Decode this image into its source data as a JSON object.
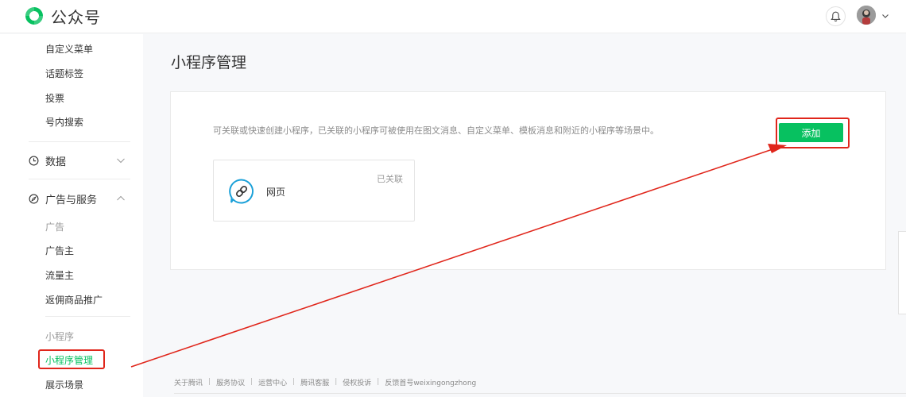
{
  "brand": {
    "name": "公众号",
    "logo_icon": "wechat-official-account-logo",
    "accent": "#07c160"
  },
  "header": {
    "notification_icon": "bell-icon",
    "avatar_icon": "avatar",
    "dropdown_icon": "chevron-down-icon"
  },
  "sidebar": {
    "top_items": [
      "自定义菜单",
      "话题标签",
      "投票",
      "号内搜索"
    ],
    "data_group": {
      "label": "数据",
      "icon": "clock-icon",
      "expanded": false
    },
    "ads_group": {
      "label": "广告与服务",
      "icon": "compass-icon",
      "expanded": true,
      "section_label": "广告",
      "items": [
        "广告主",
        "流量主",
        "返佣商品推广"
      ]
    },
    "mini_program": {
      "section_label": "小程序",
      "items": [
        "小程序管理",
        "展示场景"
      ],
      "active": "小程序管理"
    }
  },
  "main": {
    "title": "小程序管理",
    "description": "可关联或快速创建小程序，已关联的小程序可被使用在图文消息、自定义菜单、模板消息和附近的小程序等场景中。",
    "add_label": "添加",
    "card": {
      "name": "网页",
      "status": "已关联",
      "icon": "link-icon"
    }
  },
  "footer": {
    "links": [
      "关于腾讯",
      "服务协议",
      "运营中心",
      "腾讯客服",
      "侵权投诉",
      "反馈首号weixingongzhong"
    ]
  },
  "annotation": {
    "color": "#e0261b"
  }
}
